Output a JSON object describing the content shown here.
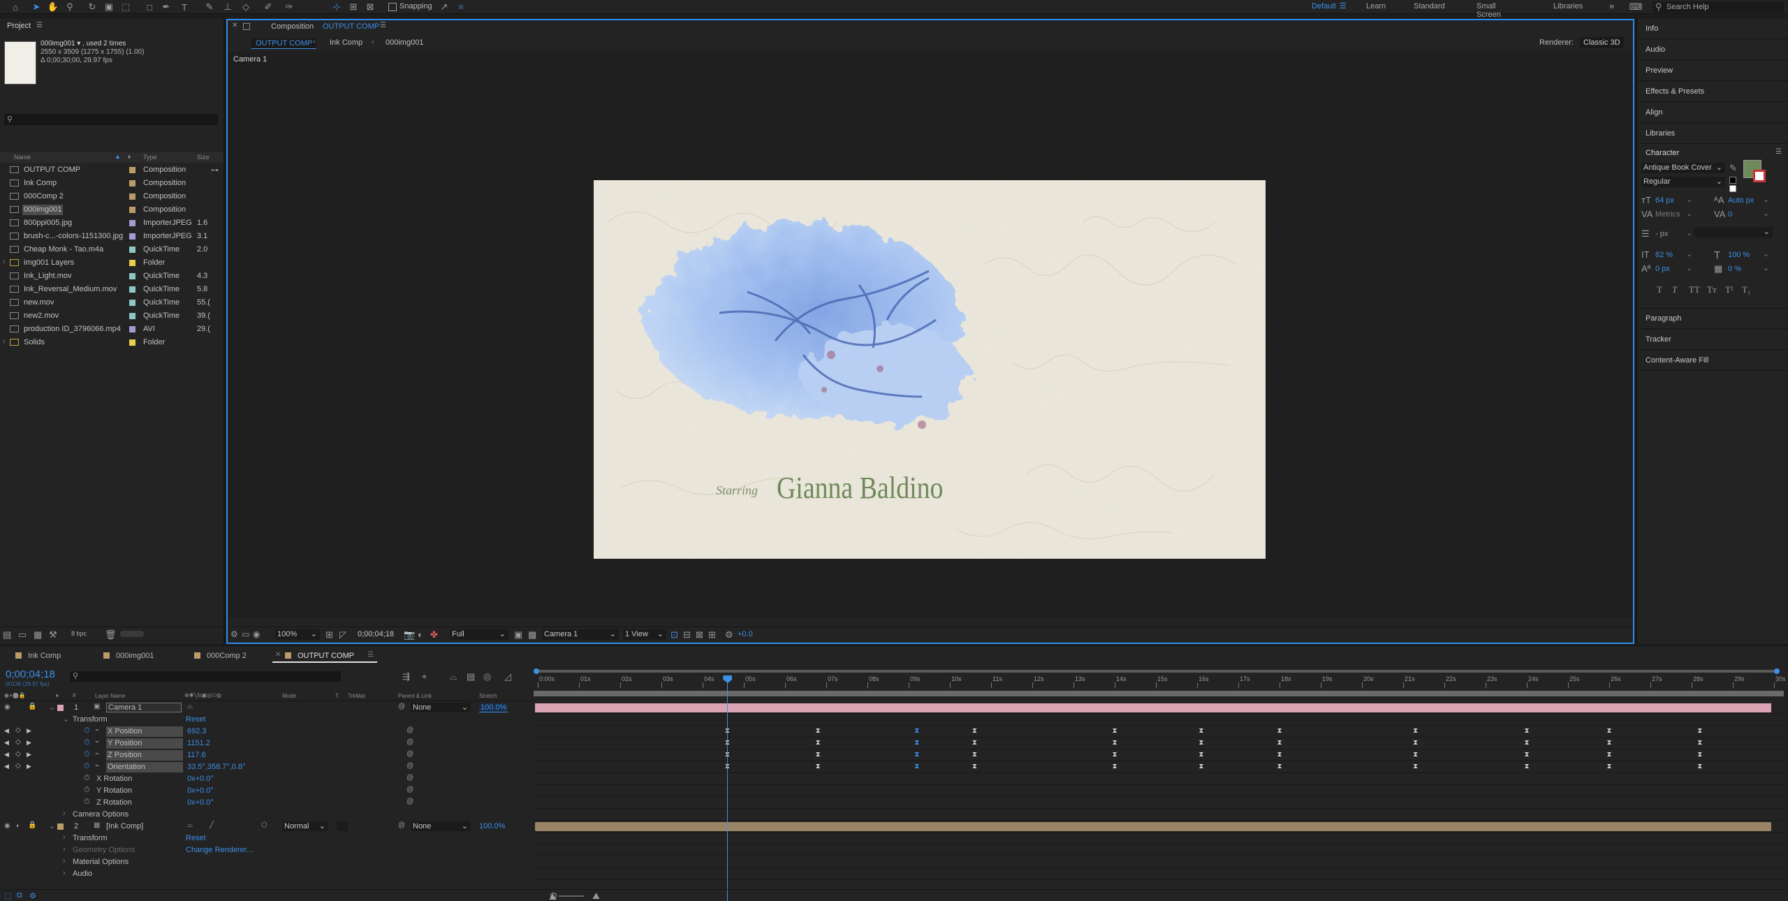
{
  "toolbar": {
    "snapping_label": "Snapping",
    "workspaces": [
      "Default",
      "Learn",
      "Standard",
      "Small Screen",
      "Libraries"
    ],
    "active_workspace": "Default",
    "search_placeholder": "Search Help"
  },
  "project": {
    "title": "Project",
    "selected_name": "000img001 ▾ , used 2 times",
    "selected_dims": "2550 x 3509  (1275 x 1755) (1.00)",
    "selected_duration": "Δ 0;00;30;00, 29.97 fps",
    "columns": {
      "name": "Name",
      "type": "Type",
      "size": "Size"
    },
    "bpc": "8 bpc",
    "items": [
      {
        "name": "OUTPUT COMP",
        "type": "Composition",
        "size": "",
        "color": "#b99c68",
        "kind": "comp"
      },
      {
        "name": "Ink Comp",
        "type": "Composition",
        "size": "",
        "color": "#b99c68",
        "kind": "comp"
      },
      {
        "name": "000Comp 2",
        "type": "Composition",
        "size": "",
        "color": "#b99c68",
        "kind": "comp"
      },
      {
        "name": "000img001",
        "type": "Composition",
        "size": "",
        "color": "#b99c68",
        "kind": "comp"
      },
      {
        "name": "800ppi005.jpg",
        "type": "ImporterJPEG",
        "size": "1.6",
        "color": "#a59bd2",
        "kind": "file"
      },
      {
        "name": "brush-c...-colors-1151300.jpg",
        "type": "ImporterJPEG",
        "size": "3.1",
        "color": "#a59bd2",
        "kind": "file"
      },
      {
        "name": "Cheap Monk - Tao.m4a",
        "type": "QuickTime",
        "size": "2.0",
        "color": "#8fc6c6",
        "kind": "file"
      },
      {
        "name": "img001 Layers",
        "type": "Folder",
        "size": "",
        "color": "#e6cf4a",
        "kind": "folder"
      },
      {
        "name": "Ink_Light.mov",
        "type": "QuickTime",
        "size": "4.3",
        "color": "#8fc6c6",
        "kind": "file"
      },
      {
        "name": "Ink_Reversal_Medium.mov",
        "type": "QuickTime",
        "size": "5.8",
        "color": "#8fc6c6",
        "kind": "file"
      },
      {
        "name": "new.mov",
        "type": "QuickTime",
        "size": "55.(",
        "color": "#8fc6c6",
        "kind": "file"
      },
      {
        "name": "new2.mov",
        "type": "QuickTime",
        "size": "39.(",
        "color": "#8fc6c6",
        "kind": "file"
      },
      {
        "name": "production ID_3796066.mp4",
        "type": "AVI",
        "size": "29.(",
        "color": "#a59bd2",
        "kind": "file"
      },
      {
        "name": "Solids",
        "type": "Folder",
        "size": "",
        "color": "#e6cf4a",
        "kind": "folder"
      }
    ]
  },
  "viewer": {
    "tab_prefix": "Composition",
    "tab_name": "OUTPUT COMP",
    "flow": [
      "OUTPUT COMP",
      "Ink Comp",
      "000img001"
    ],
    "renderer_label": "Renderer:",
    "renderer_value": "Classic 3D",
    "active_camera_label": "Camera 1",
    "canvas_text_small": "Starring",
    "canvas_text_large": "Gianna Baldino",
    "zoom": "100%",
    "timecode": "0;00;04;18",
    "resolution": "Full",
    "camera": "Camera 1",
    "views": "1 View",
    "exposure": "+0.0"
  },
  "right_panels": {
    "top_sections": [
      "Info",
      "Audio",
      "Preview",
      "Effects & Presets",
      "Align",
      "Libraries"
    ],
    "character": {
      "title": "Character",
      "font": "Antique Book Cover",
      "style": "Regular",
      "size": "64 px",
      "leading": "Auto px",
      "kerning": "Metrics",
      "tracking": "0",
      "stroke": "- px",
      "vscale": "82 %",
      "hscale": "100 %",
      "baseline": "0 px",
      "tsume": "0 %",
      "fill_color": "#6f8a5a"
    },
    "bottom_sections": [
      "Paragraph",
      "Tracker",
      "Content-Aware Fill"
    ]
  },
  "timeline": {
    "tabs": [
      {
        "label": "Ink Comp",
        "color": "#b99c68"
      },
      {
        "label": "000img001",
        "color": "#b99c68"
      },
      {
        "label": "000Comp 2",
        "color": "#b99c68"
      },
      {
        "label": "OUTPUT COMP",
        "color": "#b99c68"
      }
    ],
    "timecode": "0;00;04;18",
    "timecode_sub": "00138 (29.97 fps)",
    "columns": {
      "layer_name": "Layer Name",
      "mode": "Mode",
      "t": "T",
      "trkmat": "TrkMat",
      "parent": "Parent & Link",
      "stretch": "Stretch"
    },
    "ruler": [
      "0:00s",
      "01s",
      "02s",
      "03s",
      "04s",
      "05s",
      "06s",
      "07s",
      "08s",
      "09s",
      "10s",
      "11s",
      "12s",
      "13s",
      "14s",
      "15s",
      "16s",
      "17s",
      "18s",
      "19s",
      "20s",
      "21s",
      "22s",
      "23s",
      "24s",
      "25s",
      "26s",
      "27s",
      "28s",
      "29s",
      "30s"
    ],
    "playhead_seconds": 4.6,
    "duration_seconds": 30,
    "layer1": {
      "num": "1",
      "name": "Camera 1",
      "parent": "None",
      "stretch": "100.0%",
      "bar_color": "#d9a3b4"
    },
    "transform_label": "Transform",
    "reset_label": "Reset",
    "props": [
      {
        "name": "X Position",
        "value": "692.3",
        "keyed": true
      },
      {
        "name": "Y Position",
        "value": "1151.2",
        "keyed": true
      },
      {
        "name": "Z Position",
        "value": "117.6",
        "keyed": true
      },
      {
        "name": "Orientation",
        "value": "33.5°,358.7°,0.8°",
        "keyed": true
      },
      {
        "name": "X Rotation",
        "value": "0x+0.0°",
        "keyed": false
      },
      {
        "name": "Y Rotation",
        "value": "0x+0.0°",
        "keyed": false
      },
      {
        "name": "Z Rotation",
        "value": "0x+0.0°",
        "keyed": false
      }
    ],
    "camera_options": "Camera Options",
    "layer2": {
      "num": "2",
      "name": "[Ink Comp]",
      "mode": "Normal",
      "parent": "None",
      "stretch": "100.0%",
      "bar_color": "#9a8466"
    },
    "layer2_groups": [
      "Transform",
      "Geometry Options",
      "Material Options",
      "Audio"
    ],
    "change_renderer": "Change Renderer...",
    "keyframe_seconds": [
      4.6,
      6.8,
      9.2,
      10.6,
      14.0,
      16.1,
      18.0,
      21.3,
      24.0,
      26.0,
      28.2
    ],
    "selected_keyframe_seconds": 9.2
  }
}
